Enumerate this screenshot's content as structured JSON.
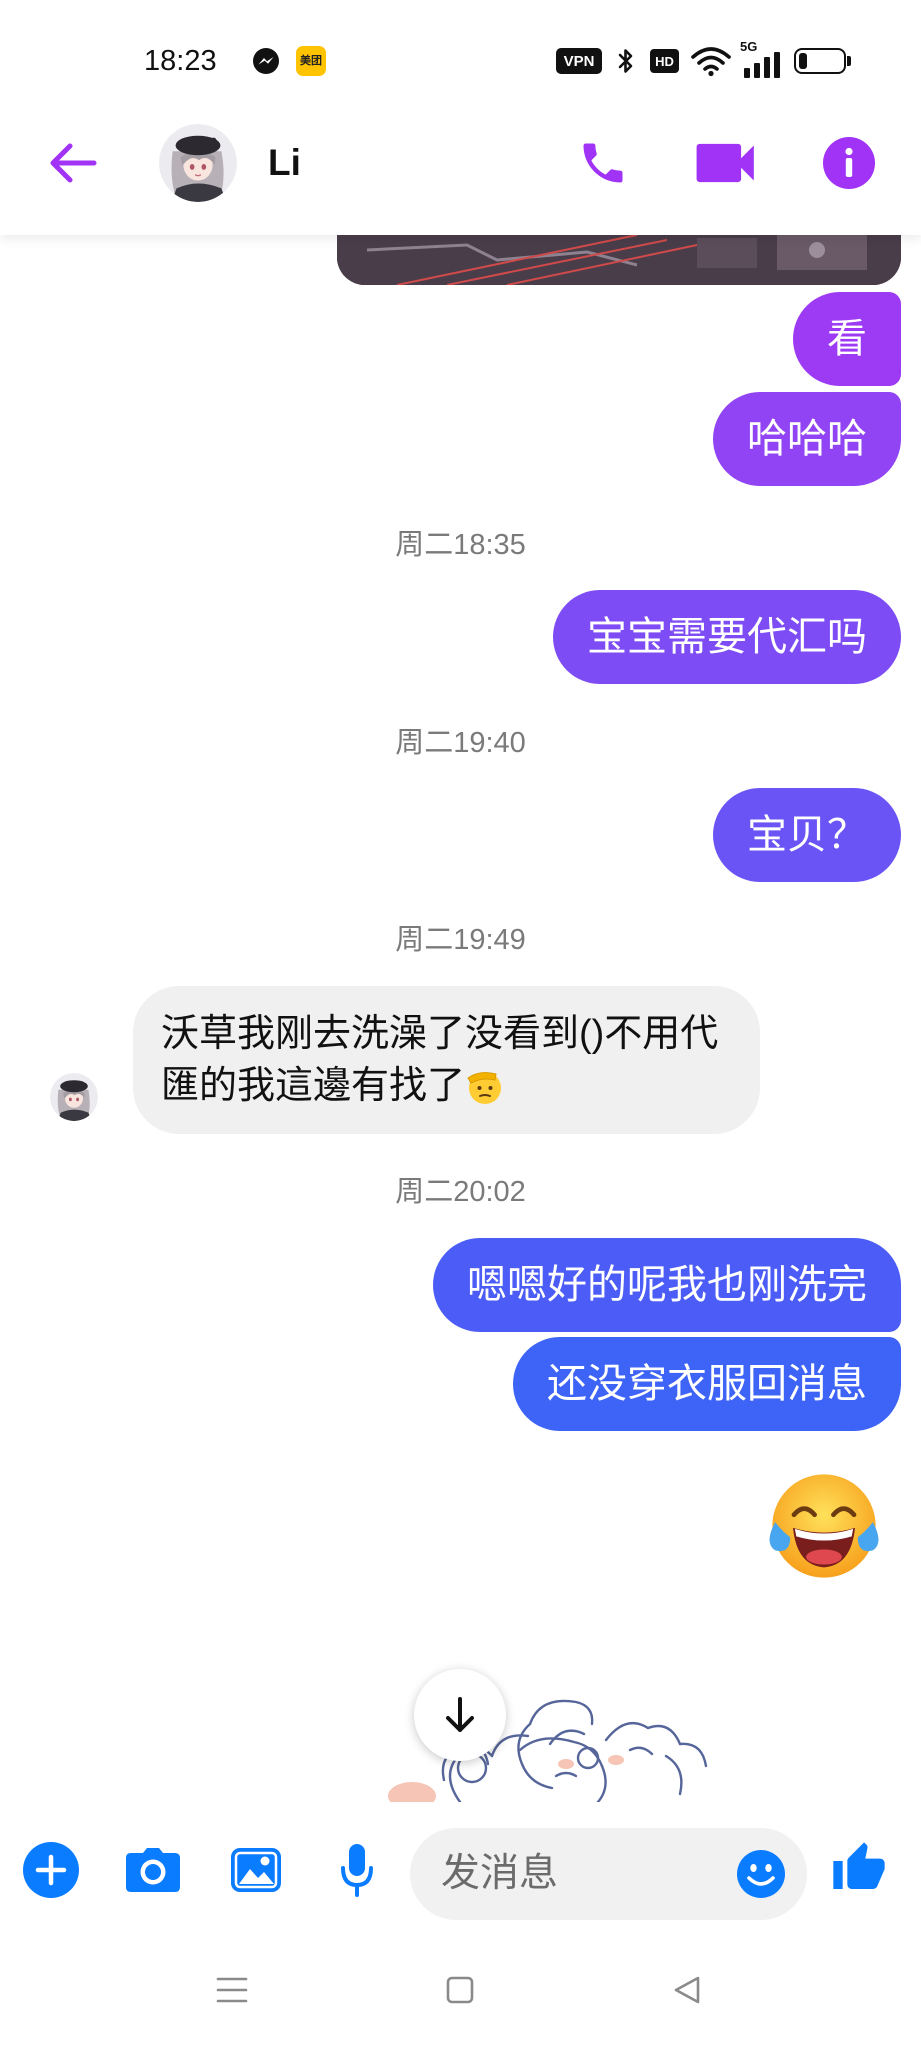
{
  "status_bar": {
    "time": "18:23",
    "meituan_label": "美团",
    "vpn_label": "VPN",
    "hd_label": "HD",
    "network_label": "5G",
    "battery_level": 0.2,
    "icons": [
      "messenger-icon",
      "bluetooth-icon",
      "wifi-icon",
      "signal-icon",
      "battery-icon"
    ]
  },
  "header": {
    "contact_name": "Li",
    "icons": [
      "back-arrow-icon",
      "contact-avatar",
      "phone-icon",
      "video-call-icon",
      "info-icon"
    ]
  },
  "colors": {
    "accent": "#a033f5",
    "messenger_blue": "#0a7cff",
    "received_bubble": "#f0f0f0",
    "timestamp": "#7a7a7a"
  },
  "thread": {
    "shared_photo": "shared-photo",
    "sent_group_1": [
      {
        "text": "看",
        "color": "#9d3af4"
      },
      {
        "text": "哈哈哈",
        "color": "#9144f4"
      }
    ],
    "timestamp_1": "周二18:35",
    "sent_2": {
      "text": "宝宝需要代汇吗",
      "color": "#7d4cf5"
    },
    "timestamp_2": "周二19:40",
    "sent_3": {
      "text": "宝贝？",
      "color": "#6a54f6"
    },
    "timestamp_3": "周二19:49",
    "received_1": {
      "text": "沃草我刚去洗澡了没看到()不用代匯的我這邊有找了",
      "emoji": "saluting-face-emoji"
    },
    "timestamp_4": "周二20:02",
    "sent_group_4": [
      {
        "text": "嗯嗯好的呢我也刚洗完",
        "color": "#4b5df6"
      },
      {
        "text": "还没穿衣服回消息",
        "color": "#3e63f7"
      }
    ],
    "big_emoji": "face-with-tears-of-joy-emoji",
    "sticker": "sheep-girl-sticker"
  },
  "scroll_button": {
    "icon": "arrow-down-icon"
  },
  "composer": {
    "placeholder": "发消息",
    "icons": [
      "add-icon",
      "camera-icon",
      "gallery-icon",
      "microphone-icon",
      "emoji-icon",
      "thumbs-up-icon"
    ]
  },
  "nav_bar": {
    "icons": [
      "recent-apps-icon",
      "home-icon",
      "back-icon"
    ]
  }
}
